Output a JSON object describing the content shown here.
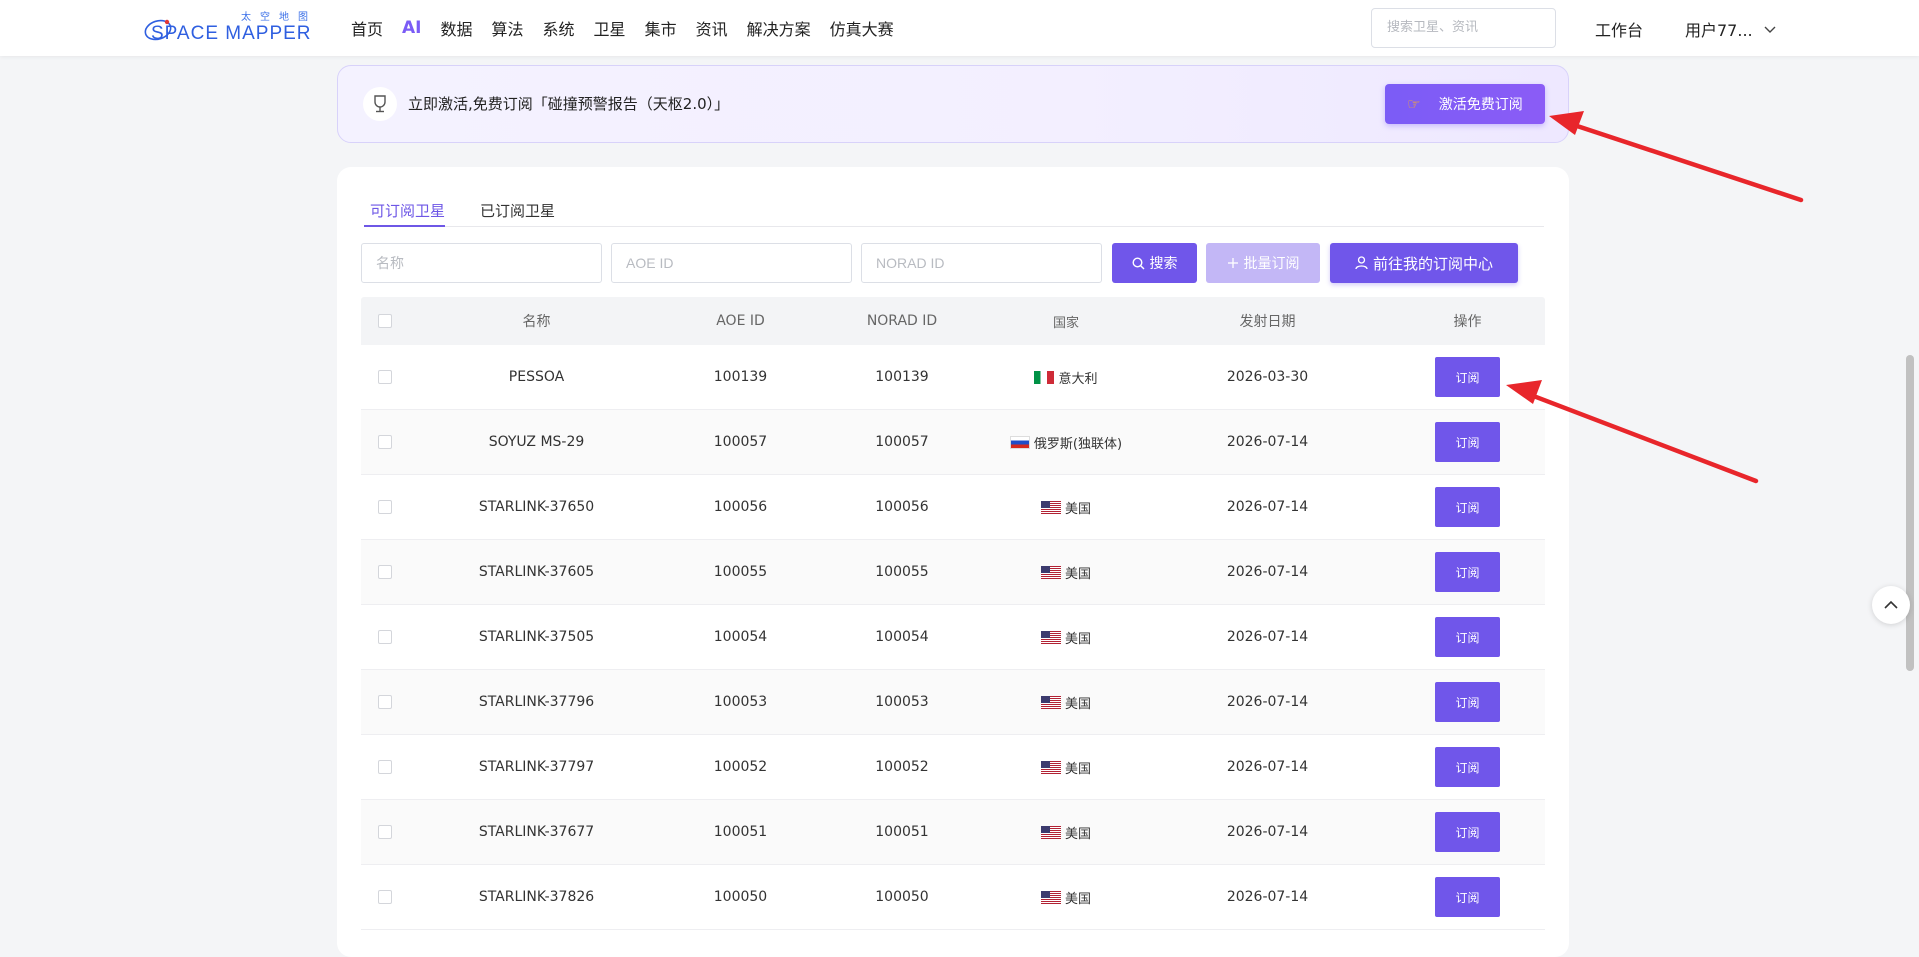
{
  "header": {
    "logo_cn": "太空地图",
    "logo_en": "SPACE MAPPER",
    "nav": [
      "首页",
      "AI",
      "数据",
      "算法",
      "系统",
      "卫星",
      "集市",
      "资讯",
      "解决方案",
      "仿真大赛"
    ],
    "search_placeholder": "搜索卫星、资讯",
    "workbench": "工作台",
    "user": "用户77..."
  },
  "promo": {
    "text": "立即激活,免费订阅「碰撞预警报告（天枢2.0）」",
    "button": "激活免费订阅"
  },
  "tabs": [
    "可订阅卫星",
    "已订阅卫星"
  ],
  "filters": {
    "name_placeholder": "名称",
    "aoe_placeholder": "AOE ID",
    "norad_placeholder": "NORAD ID"
  },
  "buttons": {
    "search": "搜索",
    "batch": "批量订阅",
    "goto": "前往我的订阅中心"
  },
  "table": {
    "columns": [
      "名称",
      "AOE ID",
      "NORAD ID",
      "国家",
      "发射日期",
      "操作"
    ],
    "rows": [
      {
        "name": "PESSOA",
        "aoe": "100139",
        "norad": "100139",
        "country": "意大利",
        "flag": "it",
        "date": "2026-03-30",
        "action": "订阅"
      },
      {
        "name": "SOYUZ MS-29",
        "aoe": "100057",
        "norad": "100057",
        "country": "俄罗斯(独联体)",
        "flag": "ru",
        "date": "2026-07-14",
        "action": "订阅"
      },
      {
        "name": "STARLINK-37650",
        "aoe": "100056",
        "norad": "100056",
        "country": "美国",
        "flag": "us",
        "date": "2026-07-14",
        "action": "订阅"
      },
      {
        "name": "STARLINK-37605",
        "aoe": "100055",
        "norad": "100055",
        "country": "美国",
        "flag": "us",
        "date": "2026-07-14",
        "action": "订阅"
      },
      {
        "name": "STARLINK-37505",
        "aoe": "100054",
        "norad": "100054",
        "country": "美国",
        "flag": "us",
        "date": "2026-07-14",
        "action": "订阅"
      },
      {
        "name": "STARLINK-37796",
        "aoe": "100053",
        "norad": "100053",
        "country": "美国",
        "flag": "us",
        "date": "2026-07-14",
        "action": "订阅"
      },
      {
        "name": "STARLINK-37797",
        "aoe": "100052",
        "norad": "100052",
        "country": "美国",
        "flag": "us",
        "date": "2026-07-14",
        "action": "订阅"
      },
      {
        "name": "STARLINK-37677",
        "aoe": "100051",
        "norad": "100051",
        "country": "美国",
        "flag": "us",
        "date": "2026-07-14",
        "action": "订阅"
      },
      {
        "name": "STARLINK-37826",
        "aoe": "100050",
        "norad": "100050",
        "country": "美国",
        "flag": "us",
        "date": "2026-07-14",
        "action": "订阅"
      }
    ]
  },
  "colors": {
    "accent": "#7056ea",
    "accent_disabled": "#c3b7f6",
    "annotation_red": "#e8262b"
  },
  "icons": [
    "trophy-cup-icon",
    "pointing-hand-icon",
    "search-icon",
    "plus-icon",
    "user-icon",
    "chevron-down-icon",
    "chevron-up-icon"
  ]
}
